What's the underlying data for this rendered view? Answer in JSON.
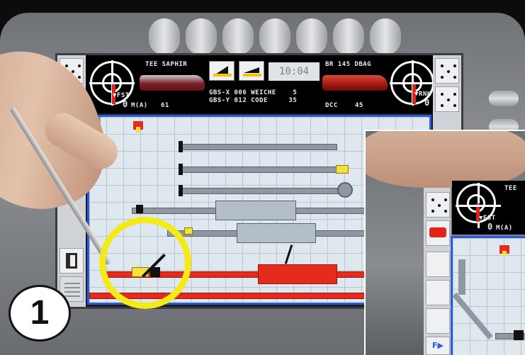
{
  "device": {
    "status": {
      "train_left": "TEE SAPHIR",
      "train_right": "BR 145 DBAG",
      "clock": "10:04",
      "speed_label_left": "▼FST",
      "speed_label_right": "▼RNH",
      "speed_value_left": "0",
      "speed_unit_left": "M(A)",
      "speed_value_right": "0",
      "address_left": "61",
      "gbs_line1": "GBS-X 006 WEICHE    5",
      "gbs_line2": "GBS-Y 012 CODE     35",
      "protocol": "DCC",
      "address_right": "45"
    },
    "side_buttons_left": [
      "dots-button",
      "direction-button",
      "track-view-button"
    ],
    "side_buttons_right": [
      "dots-button",
      "dots-button"
    ]
  },
  "callout": {
    "step_number": "1"
  },
  "inset": {
    "speed_label": "▼FST",
    "speed_value": "0",
    "speed_unit": "M(A)",
    "train_fragment": "TEE",
    "bottom_button": "F▶"
  },
  "colors": {
    "track_gray": "#8f98a2",
    "track_red": "#e52b1e",
    "highlight_yellow": "#f4ea19",
    "frame_blue": "#2d5bd6"
  }
}
